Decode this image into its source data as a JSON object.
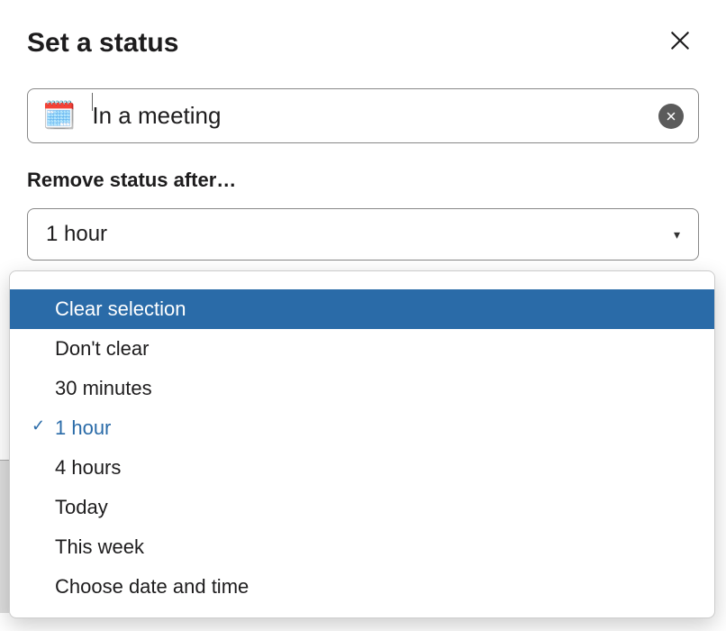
{
  "dialog": {
    "title": "Set a status"
  },
  "status": {
    "emoji": "🗓️",
    "text": "In a meeting"
  },
  "clear_after": {
    "label": "Remove status after…",
    "selected": "1 hour",
    "options": [
      {
        "label": "Clear selection",
        "highlight": true,
        "selected": false
      },
      {
        "label": "Don't clear",
        "highlight": false,
        "selected": false
      },
      {
        "label": "30 minutes",
        "highlight": false,
        "selected": false
      },
      {
        "label": "1 hour",
        "highlight": false,
        "selected": true
      },
      {
        "label": "4 hours",
        "highlight": false,
        "selected": false
      },
      {
        "label": "Today",
        "highlight": false,
        "selected": false
      },
      {
        "label": "This week",
        "highlight": false,
        "selected": false
      },
      {
        "label": "Choose date and time",
        "highlight": false,
        "selected": false
      }
    ]
  }
}
